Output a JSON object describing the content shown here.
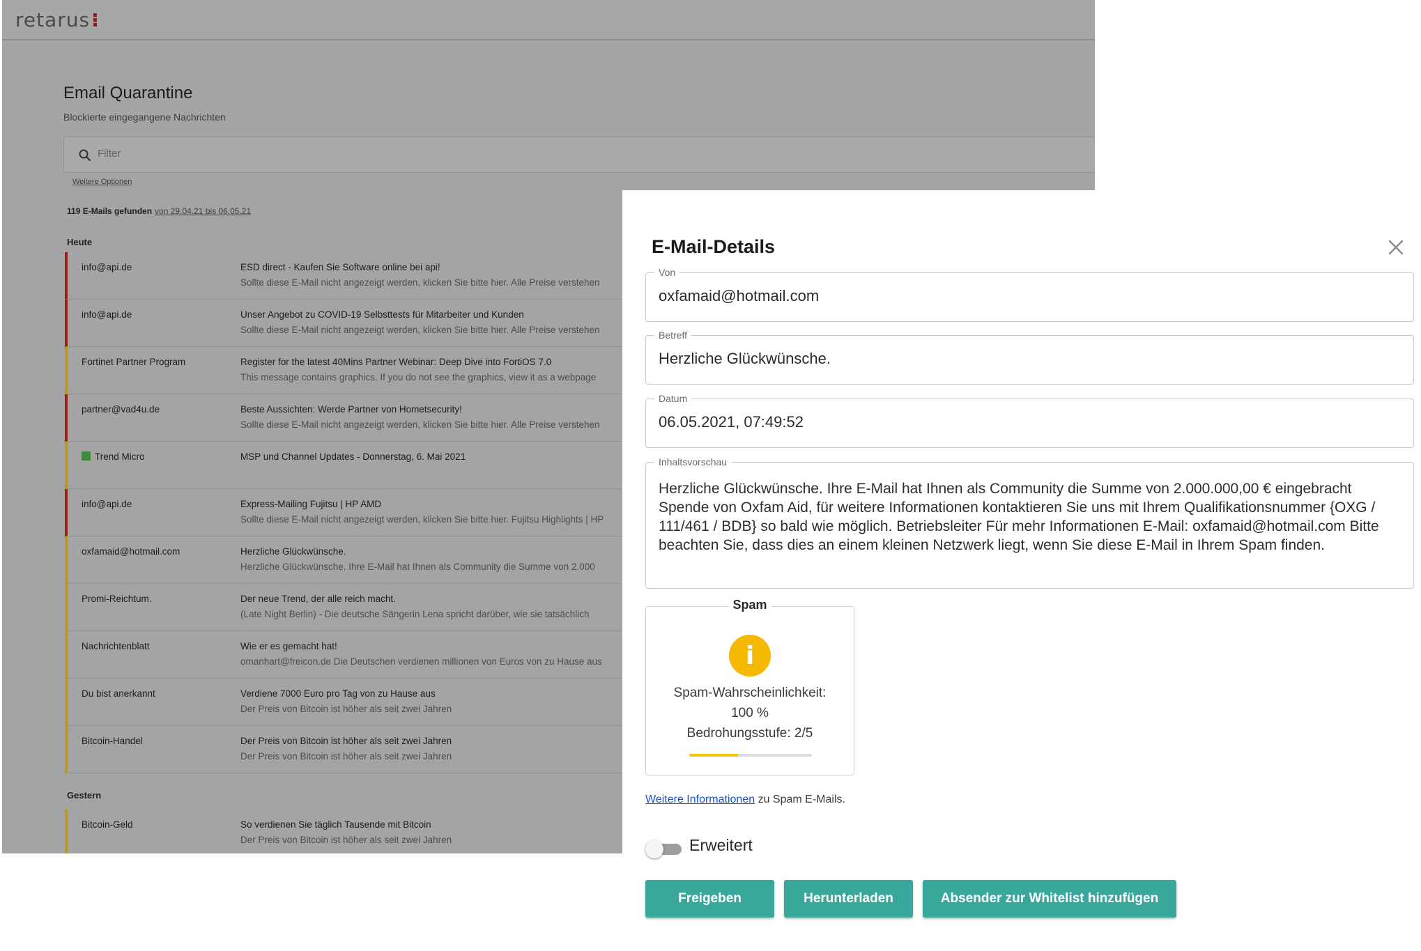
{
  "app": {
    "logo": "retarus",
    "title": "Email Quarantine",
    "subtitle": "Blockierte eingegangene Nachrichten",
    "search_placeholder": "Filter",
    "more_options": "Weitere Optionen",
    "found_count": "119 E-Mails gefunden",
    "found_range": "von 29.04.21 bis 06.05.21",
    "groups": [
      "Heute",
      "Gestern"
    ],
    "messages": [
      {
        "sender": "info@api.de",
        "subject": "ESD direct - Kaufen Sie Software online bei api!",
        "preview": "Sollte diese E-Mail nicht angezeigt werden, klicken Sie bitte hier. Alle Preise verstehen",
        "severity": "red"
      },
      {
        "sender": "info@api.de",
        "subject": "Unser Angebot zu COVID-19 Selbsttests für Mitarbeiter und Kunden",
        "preview": "Sollte diese E-Mail nicht angezeigt werden, klicken Sie bitte hier. Alle Preise verstehen",
        "severity": "red"
      },
      {
        "sender": "Fortinet Partner Program",
        "subject": "Register for the latest 40Mins Partner Webinar: Deep Dive into FortiOS 7.0",
        "preview": "This message contains graphics. If you do not see the graphics, view it as a webpage",
        "severity": "yellow"
      },
      {
        "sender": "partner@vad4u.de",
        "subject": "Beste Aussichten: Werde Partner von Hometsecurity!",
        "preview": "Sollte diese E-Mail nicht angezeigt werden, klicken Sie bitte hier. Alle Preise verstehen",
        "severity": "red"
      },
      {
        "sender": "Trend Micro",
        "subject": "MSP und Channel Updates - Donnerstag, 6. Mai 2021",
        "preview": "",
        "severity": "yellow",
        "icon": "trend-micro-icon"
      },
      {
        "sender": "info@api.de",
        "subject": "Express-Mailing Fujitsu | HP AMD",
        "preview": "Sollte diese E-Mail nicht angezeigt werden, klicken Sie bitte hier. Fujitsu Highlights | HP",
        "severity": "red"
      },
      {
        "sender": "oxfamaid@hotmail.com",
        "subject": "Herzliche Glückwünsche.",
        "preview": "Herzliche Glückwünsche. Ihre E-Mail hat Ihnen als Community die Summe von 2.000",
        "severity": "yellow"
      },
      {
        "sender": "Promi-Reichtum.",
        "subject": "Der neue Trend, der alle reich macht.",
        "preview": "(Late Night Berlin) - Die deutsche Sängerin Lena spricht darüber, wie sie tatsächlich",
        "severity": "yellow"
      },
      {
        "sender": "Nachrichtenblatt",
        "subject": "Wie er es gemacht hat!",
        "preview": "omanhart@freicon.de Die Deutschen verdienen millionen von Euros von zu Hause aus",
        "severity": "yellow"
      },
      {
        "sender": "Du bist anerkannt",
        "subject": "Verdiene 7000 Euro pro Tag von zu Hause aus",
        "preview": "Der Preis von Bitcoin ist höher als seit zwei Jahren",
        "severity": "yellow"
      },
      {
        "sender": "Bitcoin-Handel",
        "subject": "Der Preis von Bitcoin ist höher als seit zwei Jahren",
        "preview": "Der Preis von Bitcoin ist höher als seit zwei Jahren",
        "severity": "yellow"
      }
    ],
    "messages_yesterday": [
      {
        "sender": "Bitcoin-Geld",
        "subject": "So verdienen Sie täglich Tausende mit Bitcoin",
        "preview": "Der Preis von Bitcoin ist höher als seit zwei Jahren",
        "severity": "yellow"
      }
    ]
  },
  "modal": {
    "title": "E-Mail-Details",
    "from_label": "Von",
    "from_value": "oxfamaid@hotmail.com",
    "subject_label": "Betreff",
    "subject_value": "Herzliche Glückwünsche.",
    "date_label": "Datum",
    "date_value": "06.05.2021, 07:49:52",
    "preview_label": "Inhaltsvorschau",
    "preview_value": "Herzliche Glückwünsche. Ihre E-Mail hat Ihnen als Community die Summe von 2.000.000,00 € eingebracht Spende von Oxfam Aid, für weitere Informationen kontaktieren Sie uns mit Ihrem Qualifikationsnummer {OXG / 111/461 / BDB} so bald wie möglich. Betriebsleiter Für mehr Informationen E-Mail: oxfamaid@hotmail.com Bitte beachten Sie, dass dies an einem kleinen Netzwerk liegt, wenn Sie diese E-Mail in Ihrem Spam finden.",
    "spam": {
      "legend": "Spam",
      "probability_label": "Spam-Wahrscheinlichkeit:",
      "probability_value": "100 %",
      "threat_label": "Bedrohungsstufe: 2/5",
      "threat_level": 2,
      "threat_max": 5,
      "icon": "info-icon",
      "icon_color": "#f5b800"
    },
    "more_info_link": "Weitere Informationen",
    "more_info_suffix": "zu Spam E-Mails.",
    "toggle_label": "Erweitert",
    "toggle_on": false,
    "buttons": {
      "release": "Freigeben",
      "download": "Herunterladen",
      "whitelist": "Absender zur Whitelist hinzufügen"
    },
    "accent_color": "#3aa79c"
  }
}
